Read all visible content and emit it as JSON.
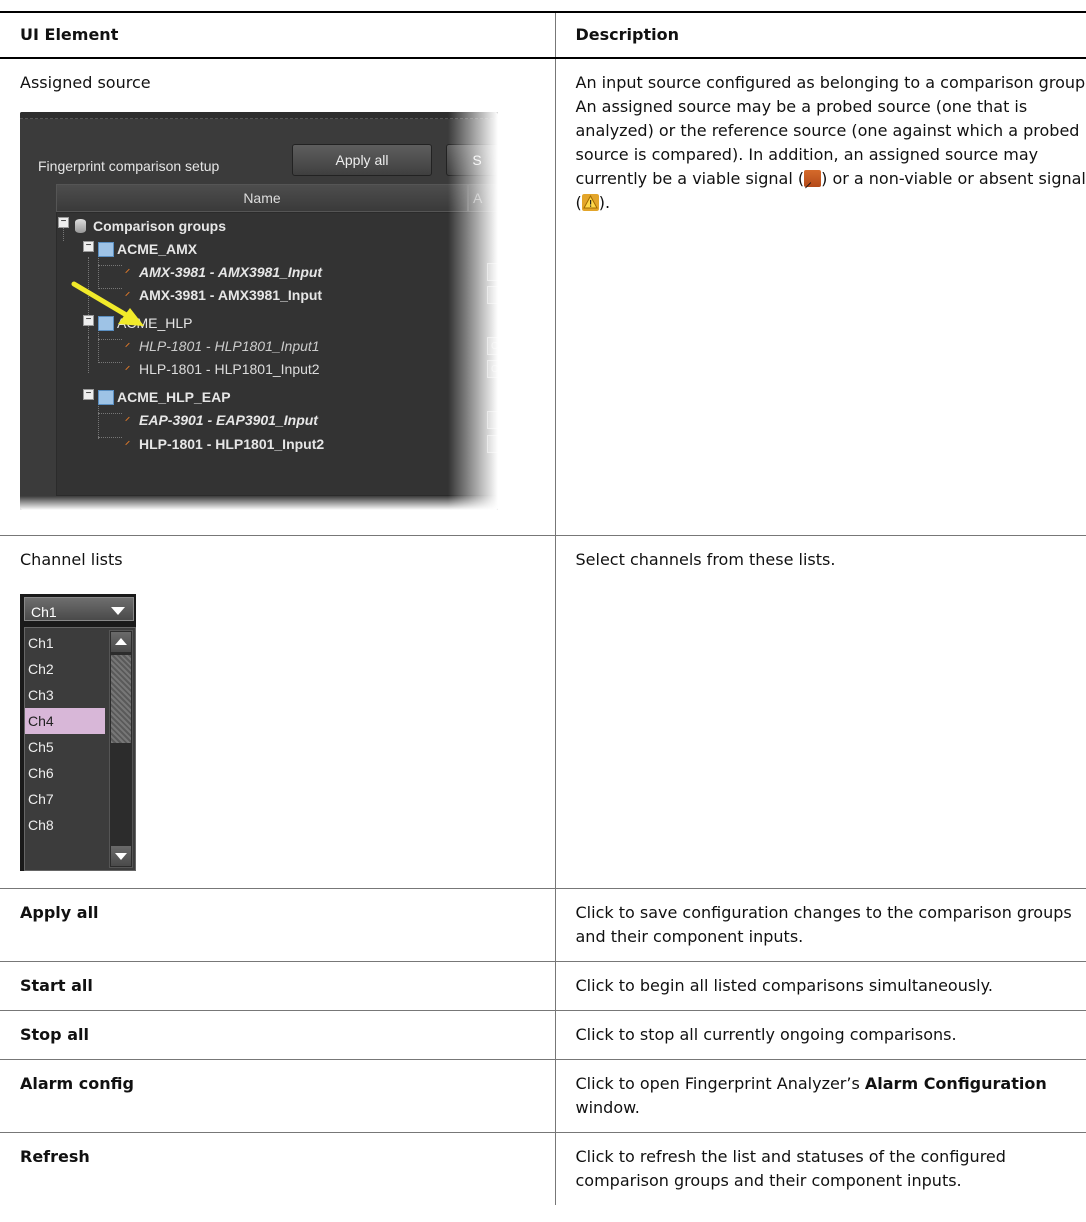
{
  "table": {
    "headers": {
      "col1": "UI Element",
      "col2": "Description"
    },
    "rows": [
      {
        "element": "Assigned source",
        "desc_a": "An input source configured as belonging to a comparison group. An assigned source may be a probed source (one that is analyzed) or the reference source (one against which a probed source is compared). In addition, an assigned source may currently be a viable signal (",
        "desc_b": ") or a non-viable or absent signal (",
        "desc_c": ")."
      },
      {
        "element": "Channel lists",
        "desc": "Select channels from these lists."
      },
      {
        "element": "Apply all",
        "desc": "Click to save configuration changes to the comparison groups and their component inputs."
      },
      {
        "element": "Start all",
        "desc": "Click to begin all listed comparisons simultaneously."
      },
      {
        "element": "Stop all",
        "desc": "Click to stop all currently ongoing comparisons."
      },
      {
        "element": "Alarm config",
        "desc_a": "Click to open Fingerprint Analyzer’s ",
        "desc_bold": "Alarm Configuration",
        "desc_b": " window."
      },
      {
        "element": "Refresh",
        "desc": "Click to refresh the list and statuses of the configured comparison groups and their component inputs."
      }
    ]
  },
  "fingerprint_panel": {
    "setup_label": "Fingerprint comparison setup",
    "apply_button": "Apply all",
    "start_button_partial": "S",
    "column_name": "Name",
    "column_partial": "A",
    "root": "Comparison groups",
    "groups": [
      {
        "name": "ACME_AMX",
        "sources": [
          "AMX-3981 - AMX3981_Input",
          "AMX-3981 - AMX3981_Input"
        ]
      },
      {
        "name": "ACME_HLP",
        "sources": [
          "HLP-1801 - HLP1801_Input1",
          "HLP-1801 - HLP1801_Input2"
        ]
      },
      {
        "name": "ACME_HLP_EAP",
        "sources": [
          "EAP-3901 - EAP3901_Input",
          "HLP-1801 - HLP1801_Input2"
        ]
      }
    ],
    "channel_button": "Ch"
  },
  "channel_list": {
    "selected": "Ch1",
    "items": [
      "Ch1",
      "Ch2",
      "Ch3",
      "Ch4",
      "Ch5",
      "Ch6",
      "Ch7",
      "Ch8"
    ],
    "highlighted": "Ch4"
  },
  "icons": {
    "viable": "rss-viable-icon",
    "nonviable": "warning-triangle-icon",
    "arrow": "yellow-arrow"
  },
  "colors": {
    "rss": "#e07a2a",
    "warn": "#f5c400",
    "selection": "#d8b7d8"
  }
}
